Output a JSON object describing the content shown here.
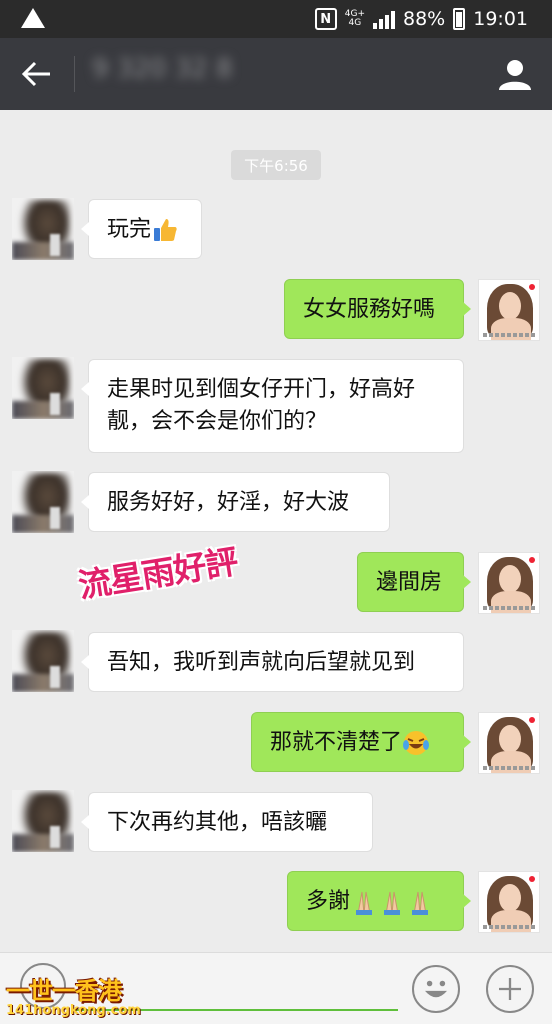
{
  "status_bar": {
    "network_top": "4G+",
    "network_bottom": "4G",
    "battery": "88%",
    "time": "19:01"
  },
  "header": {
    "contact_name": "9 320 32 8"
  },
  "chat": {
    "timestamp": "下午6:56",
    "messages": [
      {
        "side": "left",
        "text": "玩完",
        "emoji": "thumbs-up"
      },
      {
        "side": "right",
        "text": "女女服務好嗎"
      },
      {
        "side": "left",
        "text": "走果时见到個女仔开门，好高好靓，会不会是你们的？"
      },
      {
        "side": "left",
        "text": "服务好好，好淫，好大波"
      },
      {
        "side": "right",
        "text": "邊間房"
      },
      {
        "side": "left",
        "text": "吾知，我听到声就向后望就见到"
      },
      {
        "side": "right",
        "text": "那就不清楚了",
        "emoji": "crying-laughing"
      },
      {
        "side": "left",
        "text": "下次再约其他，唔該曬"
      },
      {
        "side": "right",
        "text": "多謝",
        "emoji": "praying-hands"
      }
    ]
  },
  "watermark": "流星雨好評",
  "site_logo": {
    "title": "一世一香港",
    "url": "141hongkong.com"
  },
  "colors": {
    "status_bar": "#2b2b2b",
    "title_bar": "#393a3f",
    "background": "#ececec",
    "bubble_right": "#a0e75a",
    "bubble_left": "#ffffff",
    "watermark": "#e0206a"
  }
}
